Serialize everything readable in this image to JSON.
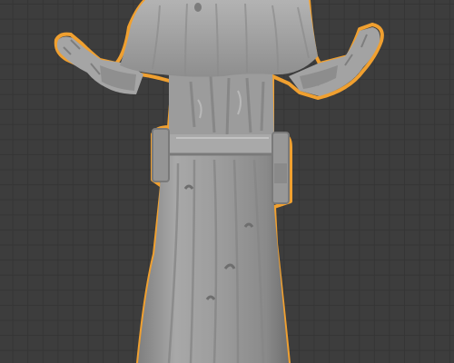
{
  "viewport": {
    "background_color": "#3d3d3d",
    "grid_line_color": "#353535",
    "selection_outline_color": "#f0a030",
    "model_color": "#9e9e9e",
    "model_shadow_color": "#7d7d7d",
    "model_highlight_color": "#bdbdbd",
    "object": {
      "icon": "sculpted-robed-figure",
      "selected": true
    }
  }
}
